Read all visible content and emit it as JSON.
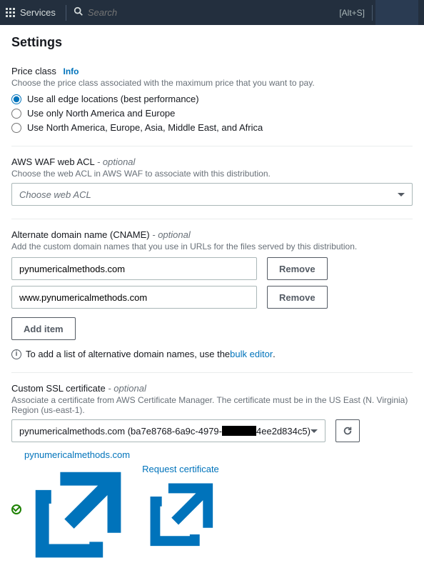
{
  "topbar": {
    "services_label": "Services",
    "search_placeholder": "Search",
    "shortcut": "[Alt+S]"
  },
  "title": "Settings",
  "price_class": {
    "label": "Price class",
    "info": "Info",
    "help": "Choose the price class associated with the maximum price that you want to pay.",
    "options": [
      "Use all edge locations (best performance)",
      "Use only North America and Europe",
      "Use North America, Europe, Asia, Middle East, and Africa"
    ]
  },
  "waf": {
    "label": "AWS WAF web ACL",
    "optional": "- optional",
    "help": "Choose the web ACL in AWS WAF to associate with this distribution.",
    "placeholder": "Choose web ACL"
  },
  "cname": {
    "label": "Alternate domain name (CNAME)",
    "optional": "- optional",
    "help": "Add the custom domain names that you use in URLs for the files served by this distribution.",
    "items": [
      "pynumericalmethods.com",
      "www.pynumericalmethods.com"
    ],
    "remove_label": "Remove",
    "add_label": "Add item",
    "bulk_prefix": "To add a list of alternative domain names, use the ",
    "bulk_link": "bulk editor"
  },
  "ssl": {
    "label": "Custom SSL certificate",
    "optional": "- optional",
    "help": "Associate a certificate from AWS Certificate Manager. The certificate must be in the US East (N. Virginia) Region (us-east-1).",
    "selected_prefix": "pynumericalmethods.com (ba7e8768-6a9c-4979-",
    "selected_suffix": "4ee2d834c5)",
    "verified_link": "pynumericalmethods.com",
    "request_link": "Request certificate"
  },
  "icons": {
    "grid": "grid-icon",
    "search": "search-icon",
    "caret": "caret-down-icon",
    "info": "info-icon",
    "refresh": "refresh-icon",
    "external": "external-link-icon",
    "check": "success-check-icon"
  }
}
